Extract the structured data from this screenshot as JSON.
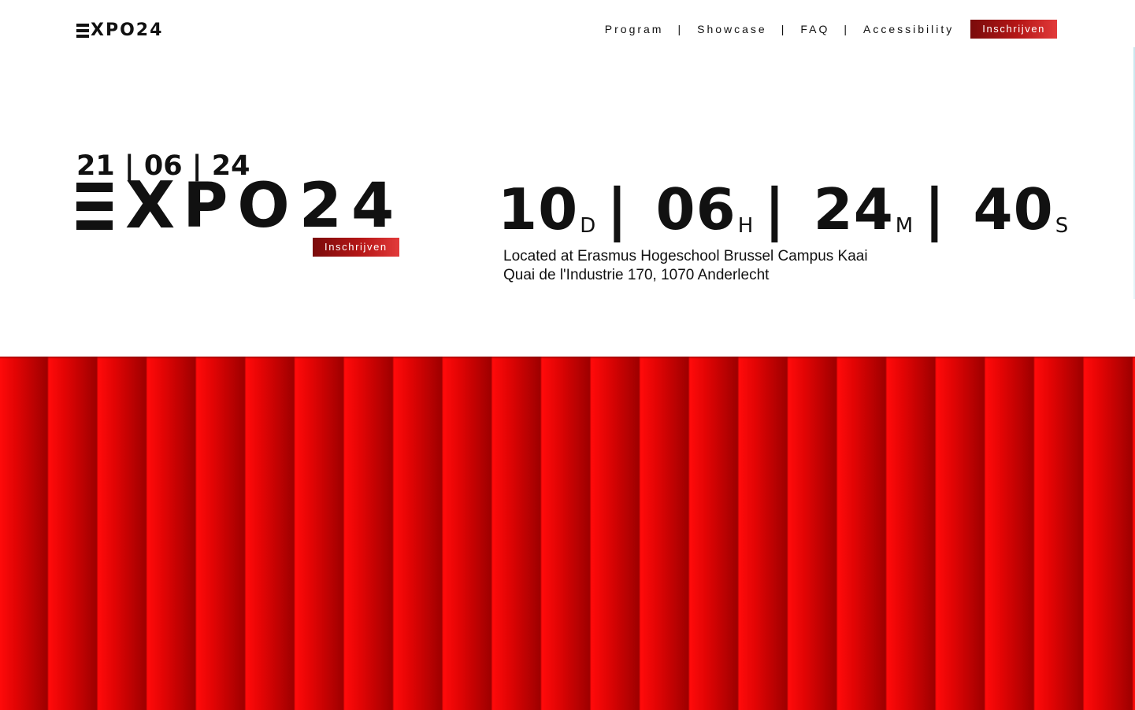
{
  "header": {
    "logo_letters": "XPO24",
    "nav": {
      "program": "Program",
      "showcase": "Showcase",
      "faq": "FAQ",
      "accessibility": "Accessibility",
      "separator": "|"
    },
    "cta": "Inschrijven"
  },
  "hero": {
    "date": "21 | 06 | 24",
    "logo_x": "X",
    "logo_letters": "PO24",
    "cta": "Inschrijven"
  },
  "countdown": {
    "days": "10",
    "days_unit": "D",
    "hours": "06",
    "hours_unit": "H",
    "minutes": "24",
    "minutes_unit": "M",
    "seconds": "40",
    "seconds_unit": "S",
    "separator": "|"
  },
  "location": {
    "line1": "Located at Erasmus Hogeschool Brussel Campus Kaai",
    "line2": "Quai de l'Industrie 170, 1070 Anderlecht"
  },
  "colors": {
    "accent": "#c4141a",
    "curtain": "#ff0a0a"
  }
}
